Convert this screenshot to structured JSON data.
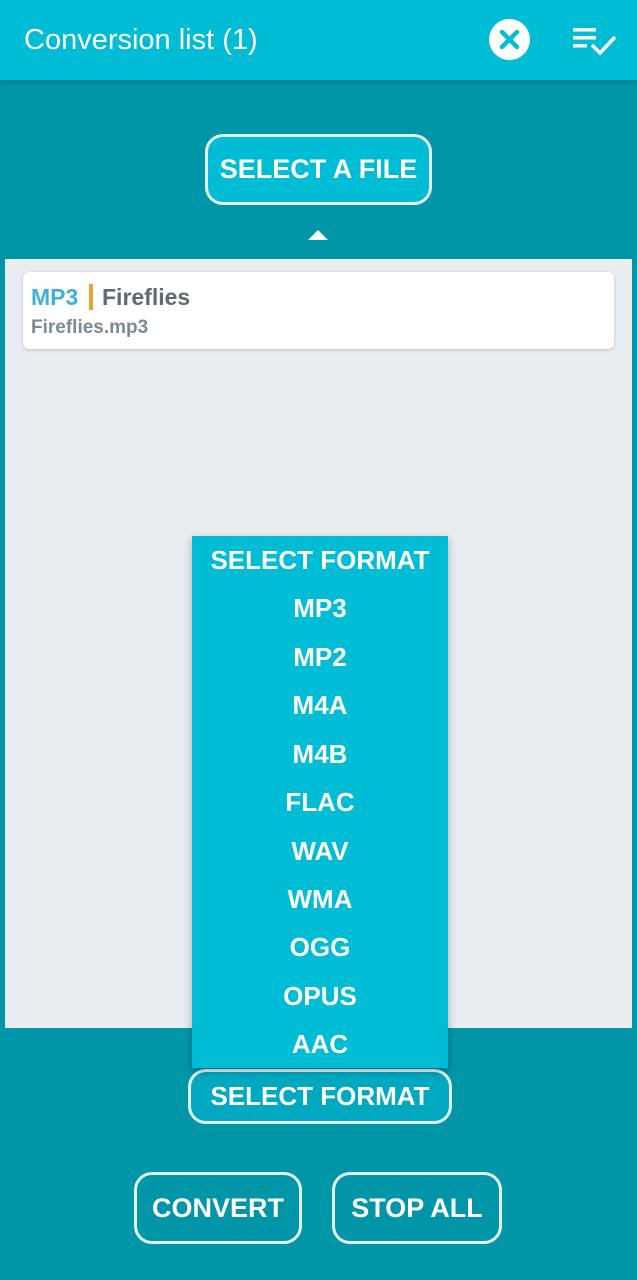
{
  "header": {
    "title": "Conversion list (1)",
    "close_icon": "close-circle-icon",
    "list_icon": "playlist-check-icon"
  },
  "select_file": {
    "label": "SELECT A FILE"
  },
  "files": [
    {
      "format": "MP3",
      "title": "Fireflies",
      "filename": "Fireflies.mp3"
    }
  ],
  "format_menu": {
    "items": [
      "SELECT FORMAT",
      "MP3",
      "MP2",
      "M4A",
      "M4B",
      "FLAC",
      "WAV",
      "WMA",
      "OGG",
      "OPUS",
      "AAC"
    ]
  },
  "select_format": {
    "label": "SELECT FORMAT"
  },
  "actions": {
    "convert": "CONVERT",
    "stop_all": "STOP ALL"
  },
  "colors": {
    "background": "#0096a8",
    "header": "#00bcd4",
    "menu": "#00bcd4",
    "list_bg": "#eaedf0",
    "format_tag": "#3fb1d3",
    "separator": "#f0a030"
  }
}
